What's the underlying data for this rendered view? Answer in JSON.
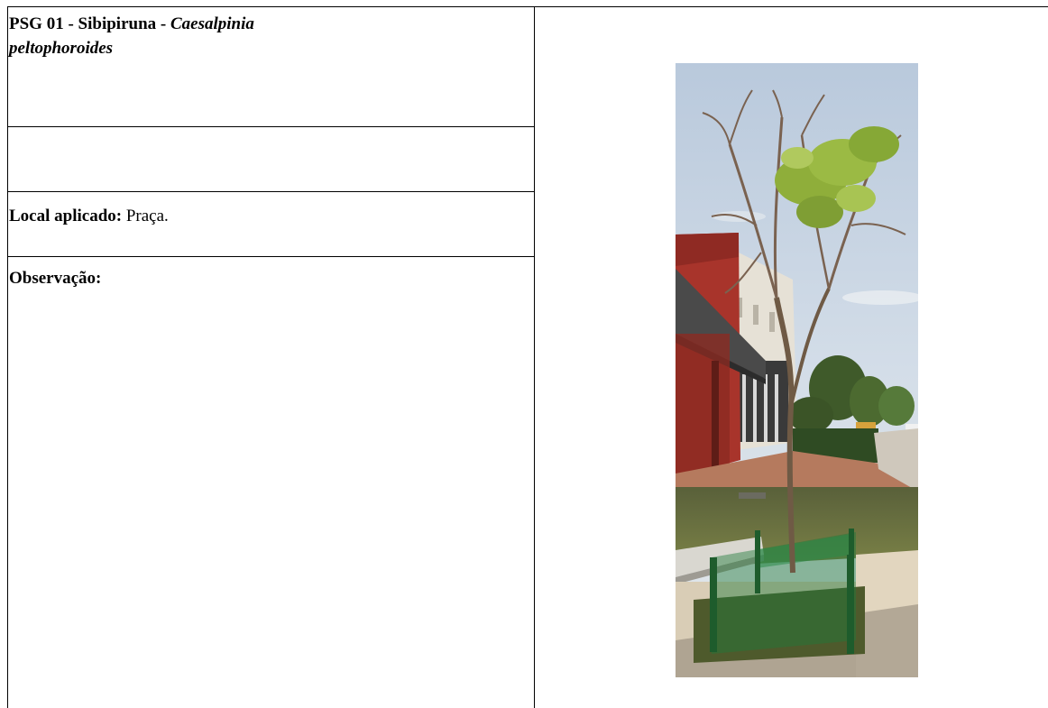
{
  "card": {
    "title_prefix": "PSG 01 - Sibipiruna - ",
    "title_species_line1": "Caesalpinia",
    "title_species_line2": "peltophoroides",
    "local_label": "Local aplicado:",
    "local_value": " Praça.",
    "observacao_label": "Observação:"
  },
  "photo": {
    "subject": "Sibipiruna tree in a plaza with green protective fence",
    "colors": {
      "sky": "#c9d6e4",
      "building_red": "#a8342b",
      "lawn": "#6f7a3e",
      "foliage": "#8fae3a",
      "fence": "#1f7a3a",
      "pavement": "#d9cdb6"
    }
  }
}
